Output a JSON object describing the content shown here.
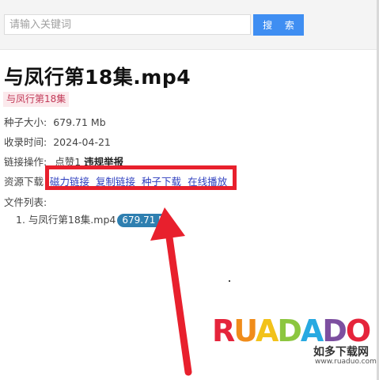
{
  "search": {
    "placeholder": "请输入关键词",
    "button_label": "搜 索"
  },
  "page": {
    "title": "与凤行第18集.mp4",
    "tag": "与凤行第18集"
  },
  "info": {
    "size_label": "种子大小:",
    "size_value": "679.71 Mb",
    "date_label": "收录时间:",
    "date_value": "2024-04-21",
    "ops_label": "链接操作:",
    "ops_like": "点赞1",
    "ops_report": "违规举报",
    "download_label": "资源下载",
    "links": [
      "磁力链接",
      "复制链接",
      "种子下载",
      "在线播放"
    ],
    "files_label": "文件列表:",
    "file_name": "1. 与凤行第18集.mp4",
    "file_size": "679.71 M"
  },
  "watermark": {
    "logo": [
      "R",
      "U",
      "A",
      "D",
      "A",
      "D",
      "O"
    ],
    "cn": "如多下载网",
    "url": "www.ruaduo.com"
  },
  "colors": {
    "accent": "#3f8ef2",
    "annotation": "#e8202d",
    "link": "#2e3fbf",
    "tag_text": "#c23a58",
    "badge": "#2e7fb0"
  }
}
